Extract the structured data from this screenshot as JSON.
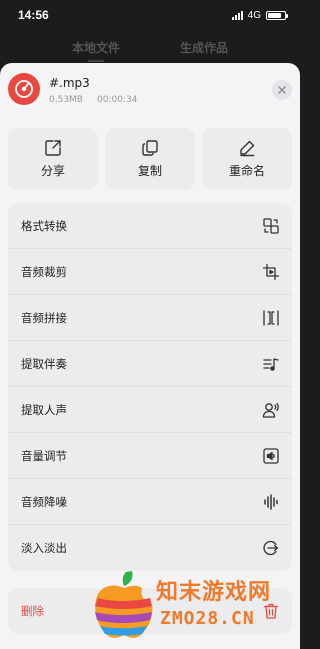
{
  "status_bar": {
    "time": "14:56",
    "network": "4G"
  },
  "background_tabs": [
    {
      "label": "本地文件"
    },
    {
      "label": "生成作品"
    }
  ],
  "file": {
    "name": "#.mp3",
    "size": "0.53MB",
    "duration": "00:00:34",
    "avatar_icon": "music-disc-icon",
    "avatar_color": "#e8483f"
  },
  "actions": [
    {
      "label": "分享",
      "icon": "share-icon"
    },
    {
      "label": "复制",
      "icon": "copy-icon"
    },
    {
      "label": "重命名",
      "icon": "edit-icon"
    }
  ],
  "menu": [
    {
      "label": "格式转换",
      "icon": "format-convert-icon"
    },
    {
      "label": "音频裁剪",
      "icon": "crop-icon"
    },
    {
      "label": "音频拼接",
      "icon": "merge-icon"
    },
    {
      "label": "提取伴奏",
      "icon": "accompaniment-icon"
    },
    {
      "label": "提取人声",
      "icon": "voice-icon"
    },
    {
      "label": "音量调节",
      "icon": "volume-icon"
    },
    {
      "label": "音频降噪",
      "icon": "noise-reduction-icon"
    },
    {
      "label": "淡入淡出",
      "icon": "fade-icon"
    }
  ],
  "delete": {
    "label": "删除",
    "icon": "trash-icon",
    "color": "#e8483f"
  },
  "watermark": {
    "cn": "知末游戏网",
    "en": "ZMO28.CN"
  },
  "colors": {
    "sheet_bg": "#f4f4f6",
    "card_bg": "#ececef",
    "accent": "#e8483f",
    "watermark": "#f07a2a"
  }
}
